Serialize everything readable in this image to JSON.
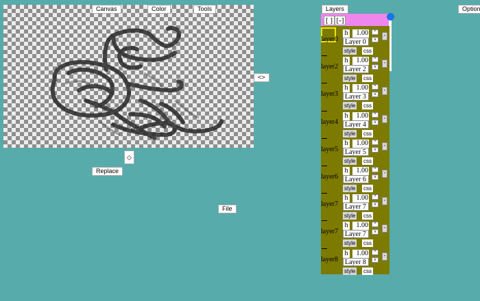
{
  "menu": {
    "canvas": "Canvas",
    "color": "Color",
    "tools": "Tools",
    "layers": "Layers",
    "options": "Options",
    "swap": "<>",
    "spinner": "◇",
    "replace": "Replace",
    "file": "File"
  },
  "layers_header": {
    "btn_a": "[ ]",
    "btn_b": "[-]"
  },
  "layers": [
    {
      "name": "layer0",
      "label": "Layer 0",
      "opacity": "1.00",
      "selected": true
    },
    {
      "name": "layer2",
      "label": "Layer 2",
      "opacity": "1.00"
    },
    {
      "name": "layer3",
      "label": "Layer 3",
      "opacity": "1.00"
    },
    {
      "name": "layer4",
      "label": "Layer 4",
      "opacity": "1.00"
    },
    {
      "name": "layer5",
      "label": "Layer 5",
      "opacity": "1.00"
    },
    {
      "name": "layer6",
      "label": "Layer 6",
      "opacity": "1.00"
    },
    {
      "name": "layer7",
      "label": "Layer 7",
      "opacity": "1.00"
    },
    {
      "name": "layer7",
      "label": "Layer 7",
      "opacity": "1.00"
    },
    {
      "name": "layer8",
      "label": "Layer 8",
      "opacity": "1.00"
    }
  ],
  "layer_controls": {
    "h": "h",
    "up": "^",
    "down": "v",
    "delete": "-",
    "style": "style",
    "css": "css"
  }
}
